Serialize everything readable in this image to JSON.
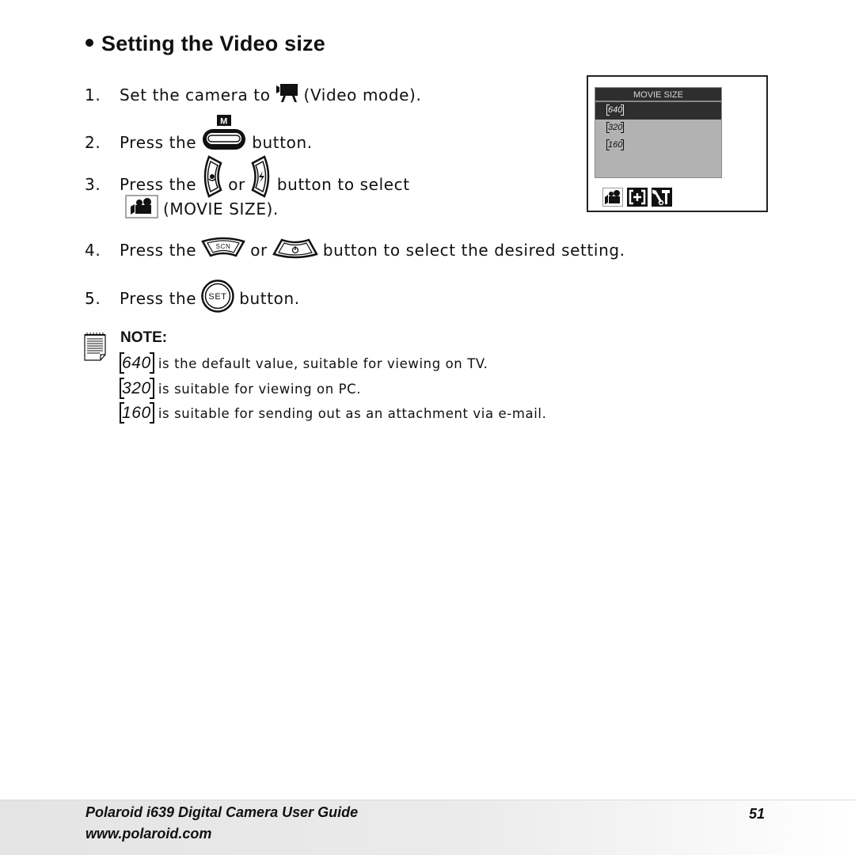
{
  "section": {
    "bullet": "•",
    "title": "Setting the Video size"
  },
  "steps": [
    {
      "number": "1.",
      "parts": [
        "Set the camera to",
        "(Video mode)."
      ],
      "icons": [
        "video-mode-icon"
      ]
    },
    {
      "number": "2.",
      "parts": [
        "Press the",
        "button."
      ],
      "icons": [
        "menu-button-icon"
      ]
    },
    {
      "number": "3.",
      "parts": [
        "Press the",
        "or",
        "button to select",
        "(MOVIE SIZE)."
      ],
      "icons": [
        "left-macro-button-icon",
        "right-flash-button-icon",
        "movie-size-icon"
      ]
    },
    {
      "number": "4.",
      "parts": [
        "Press the",
        "or",
        "button to select the desired setting."
      ],
      "icons": [
        "up-scn-button-icon",
        "down-selftimer-button-icon"
      ]
    },
    {
      "number": "5.",
      "parts": [
        "Press the",
        "button."
      ],
      "icons": [
        "set-button-icon"
      ]
    }
  ],
  "icon_labels": {
    "menu_button": "M",
    "scn_button": "SCN",
    "set_button": "SET"
  },
  "camera_screen": {
    "menu_title": "MOVIE SIZE",
    "options": [
      {
        "label": "640",
        "selected": true
      },
      {
        "label": "320",
        "selected": false
      },
      {
        "label": "160",
        "selected": false
      }
    ],
    "tabs": [
      {
        "icon": "movie-camera-icon",
        "active": true
      },
      {
        "icon": "frame-plus-icon",
        "active": false
      },
      {
        "icon": "setup-tools-icon",
        "active": false
      }
    ]
  },
  "note": {
    "label": "NOTE:",
    "items": [
      {
        "badge": "640",
        "text": "is the default value, suitable for viewing on TV."
      },
      {
        "badge": "320",
        "text": "is suitable for viewing on PC."
      },
      {
        "badge": "160",
        "text": "is suitable for sending out as an attachment via e-mail."
      }
    ]
  },
  "footer": {
    "title": "Polaroid i639 Digital Camera User Guide",
    "url": "www.polaroid.com",
    "page_number": "51"
  }
}
